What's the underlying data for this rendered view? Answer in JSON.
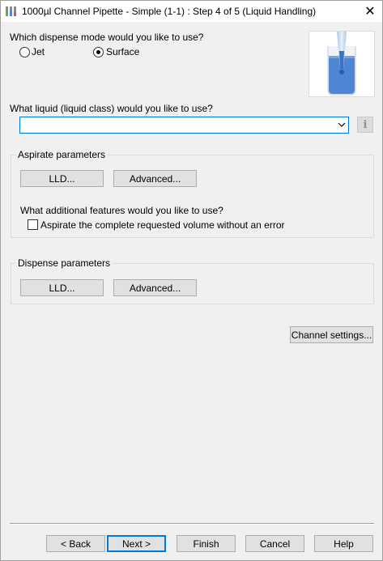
{
  "window": {
    "title": "1000µl Channel Pipette - Simple (1-1) : Step 4 of 5 (Liquid Handling)",
    "close_glyph": "✕"
  },
  "dispense_mode": {
    "question": "Which dispense mode would you like to use?",
    "options": [
      {
        "label": "Jet",
        "selected": false
      },
      {
        "label": "Surface",
        "selected": true
      }
    ]
  },
  "liquid_class": {
    "question": "What liquid (liquid class) would you like to use?",
    "value": "",
    "info_glyph": "i"
  },
  "aspirate": {
    "title": "Aspirate parameters",
    "lld_label": "LLD...",
    "advanced_label": "Advanced...",
    "features_question": "What additional features would you like to use?",
    "checkbox_label": "Aspirate the complete requested volume without an error",
    "checkbox_checked": false
  },
  "dispense": {
    "title": "Dispense parameters",
    "lld_label": "LLD...",
    "advanced_label": "Advanced..."
  },
  "channel_settings_label": "Channel settings...",
  "footer": {
    "back_label": "< Back",
    "next_label": "Next >",
    "finish_label": "Finish",
    "cancel_label": "Cancel",
    "help_label": "Help"
  },
  "colors": {
    "accent": "#0078d7",
    "liquid": "#4f86d3"
  }
}
